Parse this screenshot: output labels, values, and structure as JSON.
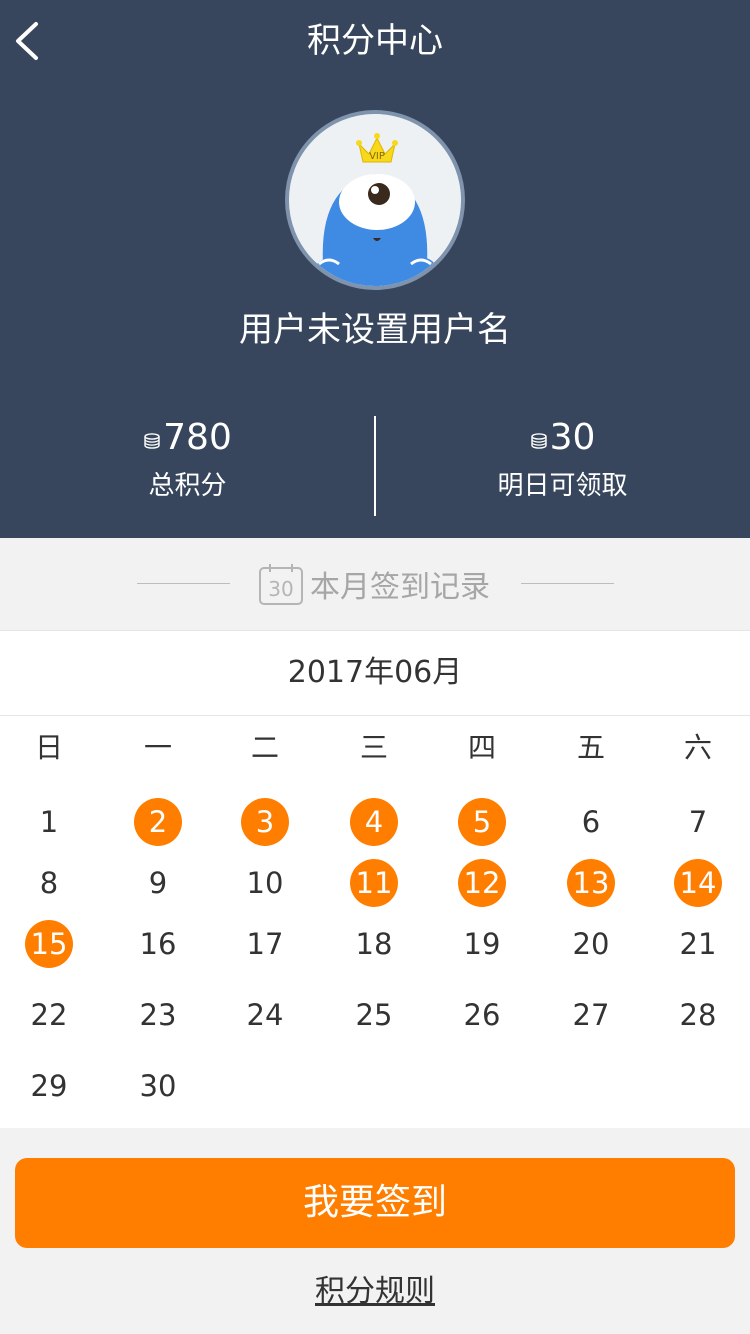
{
  "header": {
    "title": "积分中心",
    "back_icon": "chevron-left-icon",
    "background": "#37465c"
  },
  "profile": {
    "avatar_icon": "vip-monster-avatar-icon",
    "badge": "VIP",
    "username": "用户未设置用户名"
  },
  "stats": {
    "total": {
      "value": "780",
      "label": "总积分",
      "icon": "coin-stack-icon"
    },
    "tomorrow": {
      "value": "30",
      "label": "明日可领取",
      "icon": "coin-stack-icon"
    }
  },
  "records": {
    "title": "本月签到记录",
    "icon": "calendar-30-icon"
  },
  "calendar": {
    "month": "2017年06月",
    "weekdays": [
      "日",
      "一",
      "二",
      "三",
      "四",
      "五",
      "六"
    ],
    "days": [
      [
        "1",
        "2",
        "3",
        "4",
        "5",
        "6",
        "7"
      ],
      [
        "8",
        "9",
        "10",
        "11",
        "12",
        "13",
        "14"
      ],
      [
        "15",
        "16",
        "17",
        "18",
        "19",
        "20",
        "21"
      ],
      [
        "22",
        "23",
        "24",
        "25",
        "26",
        "27",
        "28"
      ],
      [
        "29",
        "30"
      ]
    ],
    "signed_days": [
      "2",
      "3",
      "4",
      "5",
      "11",
      "12",
      "13",
      "14",
      "15"
    ],
    "accent": "#ff7e00"
  },
  "actions": {
    "signin_label": "我要签到",
    "rules_label": "积分规则"
  }
}
